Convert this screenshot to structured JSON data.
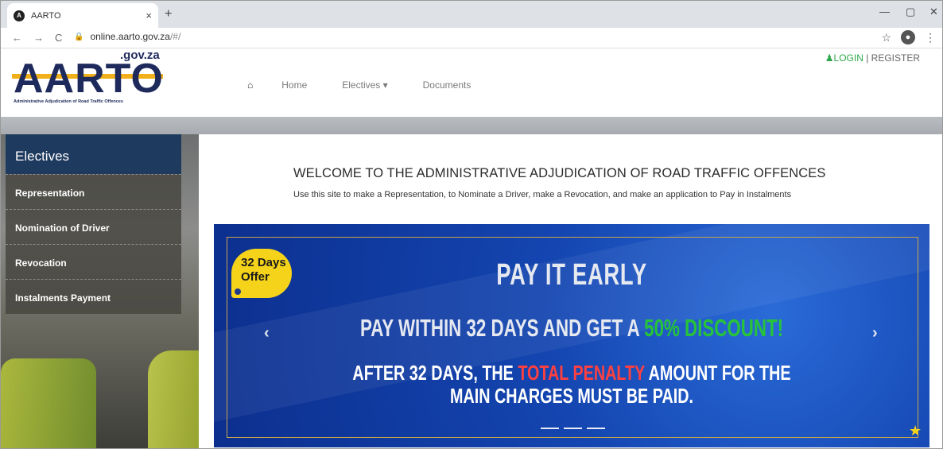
{
  "browser": {
    "tab_title": "AARTO",
    "tab_close": "×",
    "new_tab": "+",
    "url_host": "online.aarto.gov.za",
    "url_path": "/#/",
    "win_min": "—",
    "win_max": "▢",
    "win_close": "✕"
  },
  "header": {
    "logo_gov": ".gov.za",
    "logo_text": "AARTO",
    "logo_sub": "Administrative Adjudication of Road Traffic Offences",
    "nav": [
      "Home",
      "Electives ▾",
      "Documents"
    ],
    "login": "LOGIN",
    "separator": " | ",
    "register": "REGISTER"
  },
  "sidebar": {
    "title": "Electives",
    "items": [
      "Representation",
      "Nomination of Driver",
      "Revocation",
      "Instalments Payment"
    ]
  },
  "main": {
    "welcome": "WELCOME TO THE ADMINISTRATIVE ADJUDICATION OF ROAD TRAFFIC OFFENCES",
    "subline": "Use this site to make a Representation, to Nominate a Driver, make a Revocation, and make an application to Pay in Instalments"
  },
  "carousel": {
    "badge_line1": "32 Days",
    "badge_line2": "Offer",
    "headline": "PAY IT EARLY",
    "line2_a": "PAY WITHIN 32 DAYS AND GET A ",
    "line2_b": "50% DISCOUNT!",
    "line3_a": "AFTER 32 DAYS, THE ",
    "line3_b": "TOTAL PENALTY",
    "line3_c": " AMOUNT FOR THE",
    "line3_d": "MAIN CHARGES MUST BE PAID.",
    "prev": "‹",
    "next": "›"
  },
  "colors": {
    "brand_navy": "#1f2a5c",
    "login_green": "#2da84a",
    "discount_green": "#27c43a",
    "penalty_red": "#ff4040",
    "badge_yellow": "#f5d31a"
  }
}
